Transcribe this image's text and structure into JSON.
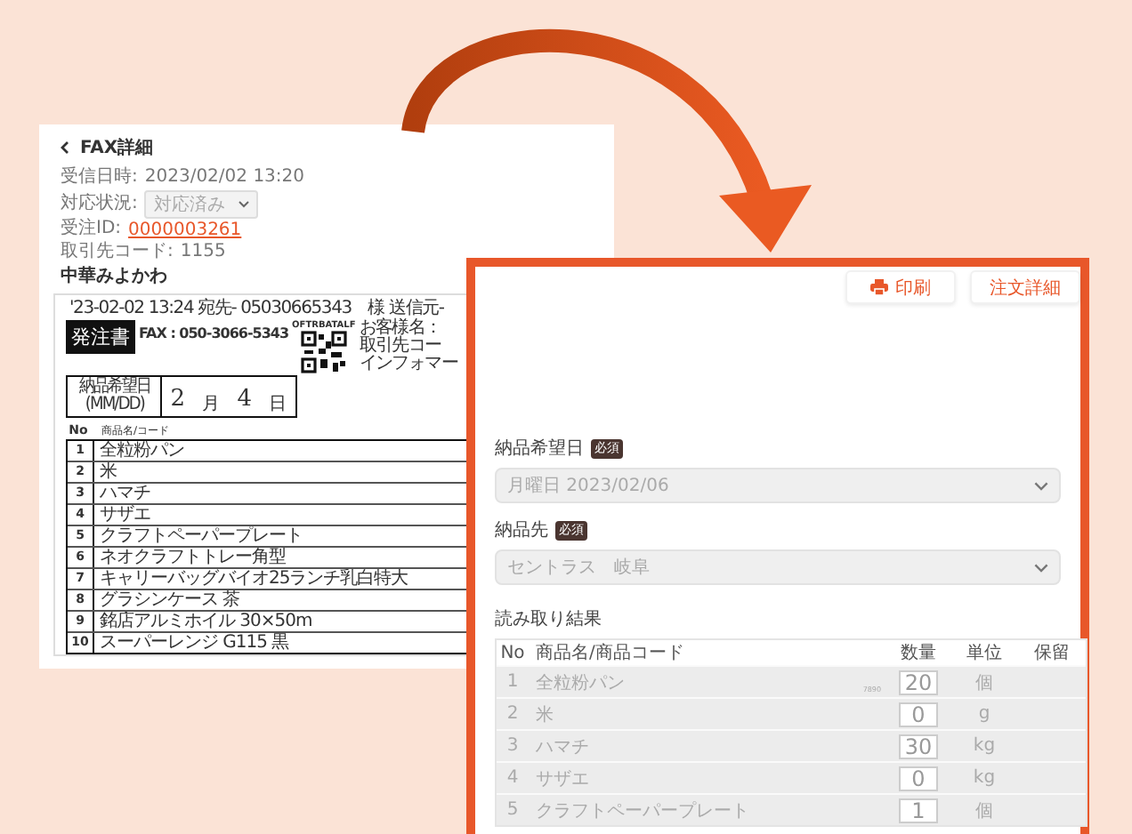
{
  "fax_detail": {
    "title": "FAX詳細",
    "fields": [
      {
        "label": "受信日時:",
        "value": "2023/02/02 13:20",
        "kind": "text"
      },
      {
        "label": "対応状況:",
        "value": "対応済み",
        "kind": "select"
      },
      {
        "label": "受注ID:",
        "value": "0000003261",
        "kind": "link"
      },
      {
        "label": "取引先コード:",
        "value": "1155",
        "kind": "text"
      }
    ],
    "customer": "中華みよかわ",
    "fax_sheet": {
      "header_line": "'23-02-02 13:24 宛先- 05030665343　様 送信元-",
      "doc_title": "発注書",
      "fax_number": "FAX : 050-3066-5343",
      "qr_label": "OFTRBATALF",
      "side_labels": [
        "お客様名：",
        "取引先コー",
        "インフォマー"
      ],
      "date_box": {
        "label": "納品希望日",
        "format": "(MM/DD)",
        "month": "2",
        "month_unit": "月",
        "day": "4",
        "day_unit": "日"
      },
      "columns": [
        "No",
        "商品名/コード"
      ],
      "rows": [
        {
          "no": "1",
          "name": "全粒粉パン"
        },
        {
          "no": "2",
          "name": "米"
        },
        {
          "no": "3",
          "name": "ハマチ"
        },
        {
          "no": "4",
          "name": "サザエ"
        },
        {
          "no": "5",
          "name": "クラフトペーパープレート"
        },
        {
          "no": "6",
          "name": "ネオクラフトトレー角型"
        },
        {
          "no": "7",
          "name": "キャリーバッグバイオ25ランチ乳白特大"
        },
        {
          "no": "8",
          "name": "グラシンケース 茶"
        },
        {
          "no": "9",
          "name": "銘店アルミホイル 30×50m"
        },
        {
          "no": "10",
          "name": "スーパーレンジ G115 黒"
        }
      ]
    }
  },
  "order_form": {
    "buttons": [
      {
        "label": "印刷",
        "kind": "print"
      },
      {
        "label": "注文詳細",
        "kind": "plain"
      }
    ],
    "fields": [
      {
        "label": "納品希望日",
        "badge": "必須",
        "value": "月曜日 2023/02/06"
      },
      {
        "label": "納品先",
        "badge": "必須",
        "value": "セントラス　岐阜"
      }
    ],
    "results_title": "読み取り結果",
    "columns": [
      "No",
      "商品名/商品コード",
      "数量",
      "単位",
      "保留"
    ],
    "rows": [
      {
        "no": "1",
        "name": "全粒粉パン",
        "code": "7890",
        "quantity": "20",
        "unit": "個"
      },
      {
        "no": "2",
        "name": "米",
        "quantity": "0",
        "unit": "g"
      },
      {
        "no": "3",
        "name": "ハマチ",
        "quantity": "30",
        "unit": "kg"
      },
      {
        "no": "4",
        "name": "サザエ",
        "quantity": "0",
        "unit": "kg"
      },
      {
        "no": "5",
        "name": "クラフトペーパープレート",
        "quantity": "1",
        "unit": "個"
      }
    ]
  }
}
